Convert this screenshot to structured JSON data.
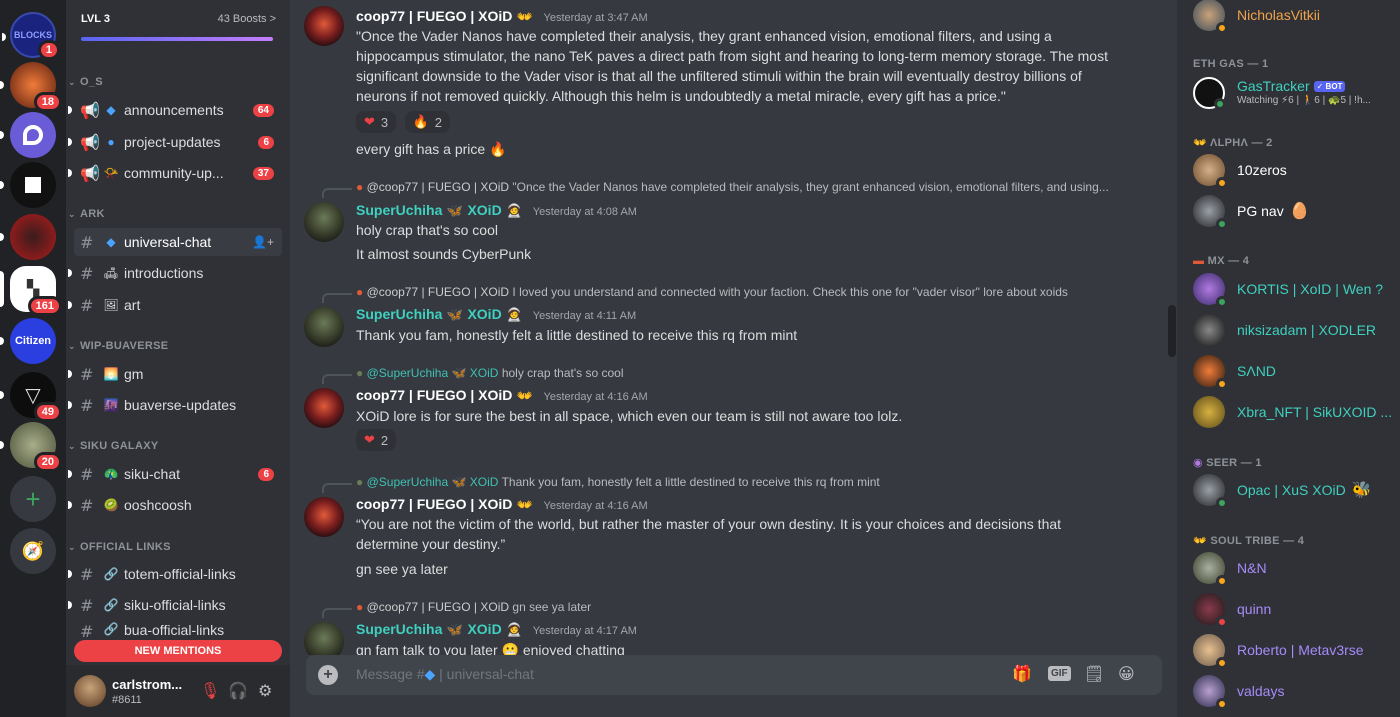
{
  "servers": [
    {
      "label": "BLOCKS",
      "badge": "1",
      "color": "#1a237e"
    },
    {
      "label": "",
      "badge": "18",
      "color": "#8a3b1e"
    },
    {
      "label": "",
      "badge": "",
      "color": "#6a5cd6"
    },
    {
      "label": "",
      "badge": "",
      "color": "#111111"
    },
    {
      "label": "",
      "badge": "",
      "color": "#b01c1c"
    },
    {
      "label": "",
      "badge": "161",
      "color": "#ffffff"
    },
    {
      "label": "Citizen",
      "badge": "",
      "color": "#2b3fe0"
    },
    {
      "label": "",
      "badge": "49",
      "color": "#0d0d0d"
    },
    {
      "label": "",
      "badge": "20",
      "color": "#6b7355"
    }
  ],
  "boost": {
    "level": "LVL 3",
    "count": "43 Boosts >"
  },
  "categories": {
    "os": "O_S",
    "ark": "ARK",
    "wip": "WIP-BUAVERSE",
    "siku": "SIKU GALAXY",
    "links": "OFFICIAL LINKS"
  },
  "channels": {
    "announcements": {
      "name": "announcements",
      "badge": "64"
    },
    "project_updates": {
      "name": "project-updates",
      "badge": "6"
    },
    "community": {
      "name": "community-up...",
      "badge": "37"
    },
    "universal": {
      "name": "universal-chat"
    },
    "introductions": {
      "name": "introductions"
    },
    "art": {
      "name": "art"
    },
    "gm": {
      "name": "gm"
    },
    "buaverse": {
      "name": "buaverse-updates"
    },
    "siku_chat": {
      "name": "siku-chat",
      "badge": "6"
    },
    "ooshcoosh": {
      "name": "ooshcoosh"
    },
    "totem": {
      "name": "totem-official-links"
    },
    "siku_links": {
      "name": "siku-official-links"
    },
    "bua_links": {
      "name": "bua-official-links"
    }
  },
  "new_mentions": "NEW MENTIONS",
  "user": {
    "name": "carlstrom...",
    "tag": "#8611"
  },
  "messages": {
    "m1": {
      "author": "coop77 | FUEGO | XOiD",
      "time": "Yesterday at 3:47 AM",
      "text": "\"Once the Vader Nanos have completed their analysis, they grant enhanced vision, emotional filters, and using a hippocampus stimulator, the nano TeK paves a direct path from sight and hearing to long-term memory storage. The most significant downside to the Vader visor is that all the unfiltered stimuli within the brain will eventually destroy billions of neurons if not removed quickly. Although this helm is undoubtedly a metal miracle, every gift has a price.\"",
      "reactions": [
        {
          "emoji": "❤",
          "count": "3"
        },
        {
          "emoji": "🔥",
          "count": "2"
        }
      ],
      "followup": "every gift has a price"
    },
    "m2": {
      "reply_author": "@coop77 | FUEGO | XOiD",
      "reply_text": "\"Once the Vader Nanos have completed their analysis, they grant enhanced vision, emotional filters, and using...",
      "author": "SuperUchiha",
      "author_suffix": "XOiD",
      "time": "Yesterday at 4:08 AM",
      "text": "holy crap that's so cool",
      "followup": "It almost sounds CyberPunk"
    },
    "m3": {
      "reply_author": "@coop77 | FUEGO | XOiD",
      "reply_text": "I loved you understand and connected with your faction. Check this one for \"vader visor\" lore about xoids",
      "author": "SuperUchiha",
      "author_suffix": "XOiD",
      "time": "Yesterday at 4:11 AM",
      "text": "Thank you fam, honestly felt a little destined to receive this rq from mint"
    },
    "m4": {
      "reply_author": "@SuperUchiha",
      "reply_suffix": "XOiD",
      "reply_text": "holy crap that's so cool",
      "author": "coop77 | FUEGO | XOiD",
      "time": "Yesterday at 4:16 AM",
      "text": "XOiD lore is for sure the best in all space, which even our team is still not aware too lolz.",
      "reactions": [
        {
          "emoji": "❤",
          "count": "2"
        }
      ]
    },
    "m5": {
      "reply_author": "@SuperUchiha",
      "reply_suffix": "XOiD",
      "reply_text": "Thank you fam, honestly felt a little destined to receive this rq from mint",
      "author": "coop77 | FUEGO | XOiD",
      "time": "Yesterday at 4:16 AM",
      "text": "“You are not the victim of the world, but rather the master of your own destiny. It is your choices and decisions that determine your destiny.”",
      "followup": "gn see ya later"
    },
    "m6": {
      "reply_author": "@coop77 | FUEGO | XOiD",
      "reply_text": "gn see ya later",
      "author": "SuperUchiha",
      "author_suffix": "XOiD",
      "time": "Yesterday at 4:17 AM",
      "text": "gn fam talk to you later",
      "text_tail": "enjoyed chatting"
    }
  },
  "composer": {
    "placeholder": "Message #",
    "channel": "| universal-chat"
  },
  "members": {
    "top": {
      "name": "NicholasVitkii",
      "color": "#f0a34a"
    },
    "eth_cat": "ETH GAS — 1",
    "gastracker": {
      "name": "GasTracker",
      "bot": "✓ BOT",
      "sub": "Watching ⚡6 | 🚶6 | 🐢5 | !h..."
    },
    "alpha_cat": "ΛLPHΛ — 2",
    "alpha": [
      {
        "name": "10zeros"
      },
      {
        "name": "PG nav"
      }
    ],
    "mx_cat": "MX — 4",
    "mx": [
      {
        "name": "KORTIS | XoID | Wen ?"
      },
      {
        "name": "niksizadam | XODLER"
      },
      {
        "name": "SΛND"
      },
      {
        "name": "Xbra_NFT | SikUXOID ..."
      }
    ],
    "seer_cat": "SEER — 1",
    "seer": [
      {
        "name": "Opac | XuS XOiD"
      }
    ],
    "soul_cat": "SOUL TRIBE — 4",
    "soul": [
      {
        "name": "N&N"
      },
      {
        "name": "quinn"
      },
      {
        "name": "Roberto | Metav3rse"
      },
      {
        "name": "valdays"
      }
    ]
  }
}
